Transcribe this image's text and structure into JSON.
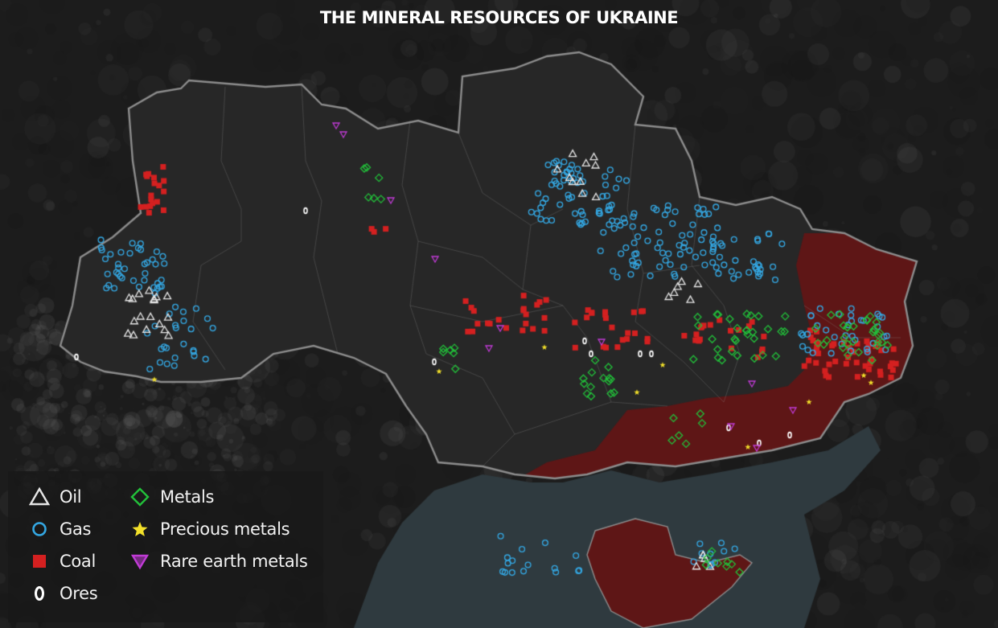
{
  "title": "THE MINERAL RESOURCES OF UKRAINE",
  "legend": [
    {
      "key": "oil",
      "label": "Oil",
      "icon": "triangle-up-outline-icon",
      "color": "#e6e6e6"
    },
    {
      "key": "gas",
      "label": "Gas",
      "icon": "circle-outline-icon",
      "color": "#34a7e2"
    },
    {
      "key": "coal",
      "label": "Coal",
      "icon": "filled-square-icon",
      "color": "#d42020"
    },
    {
      "key": "ores",
      "label": "Ores",
      "icon": "zero-glyph-icon",
      "color": "#ffffff"
    },
    {
      "key": "metals",
      "label": "Metals",
      "icon": "diamond-outline-icon",
      "color": "#22c03a"
    },
    {
      "key": "precious",
      "label": "Precious metals",
      "icon": "star-icon",
      "color": "#f3e12a"
    },
    {
      "key": "rare",
      "label": "Rare earth metals",
      "icon": "triangle-down-icon",
      "color": "#c13bd6"
    }
  ],
  "colors": {
    "background": "#1c1c1c",
    "land": "#272727",
    "border": "#8d8d8d",
    "occupied": "#5e1616",
    "sea": "#2f3a3f"
  }
}
